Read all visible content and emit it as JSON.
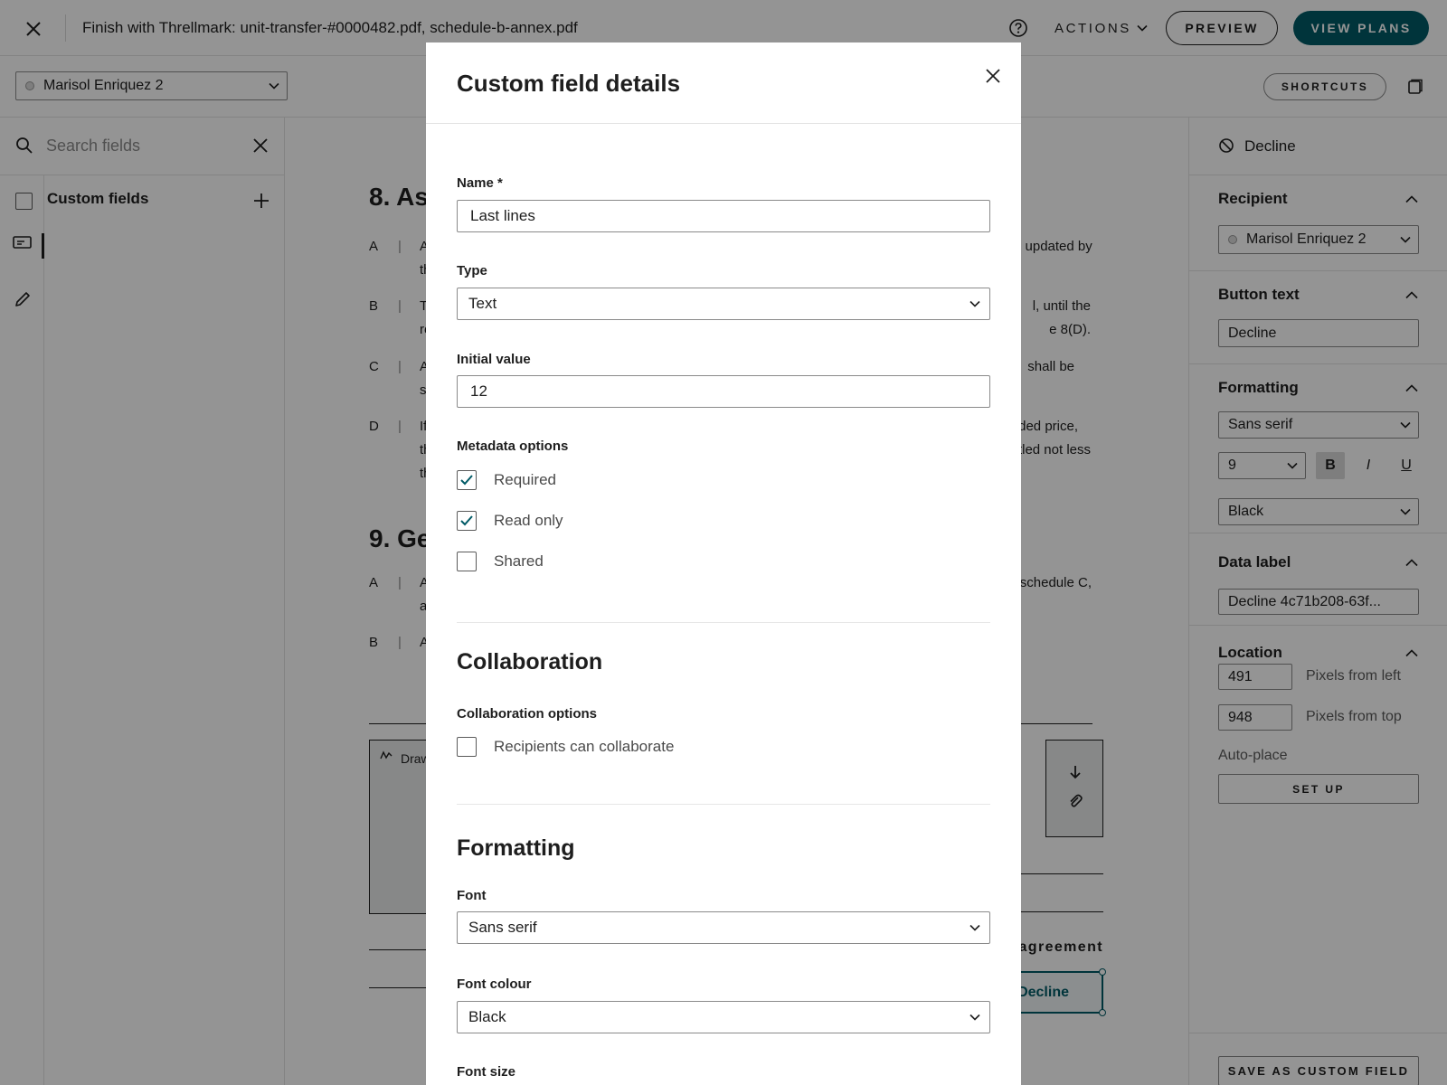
{
  "topbar": {
    "title": "Finish with Threllmark: unit-transfer-#0000482.pdf, schedule-b-annex.pdf",
    "actions_label": "ACTIONS",
    "preview_label": "PREVIEW",
    "view_plans_label": "VIEW PLANS"
  },
  "subbar": {
    "recipient_select": "Marisol Enriquez 2",
    "shortcuts_label": "SHORTCUTS"
  },
  "left_panel": {
    "search_placeholder": "Search fields",
    "custom_fields_label": "Custom fields"
  },
  "document": {
    "heading8": "8. As",
    "heading9": "9. Ge",
    "rows": [
      {
        "letter": "A",
        "frag_left": "A",
        "frag_left2": "th",
        "frag_right": "n updated by",
        "frag_right2": ""
      },
      {
        "letter": "B",
        "frag_left": "T",
        "frag_left2": "re",
        "frag_right": "l, until the",
        "frag_right2": "e 8(D)."
      },
      {
        "letter": "C",
        "frag_left": "A",
        "frag_left2": "s",
        "frag_right": "shall be",
        "frag_right2": ""
      },
      {
        "letter": "D",
        "frag_left": "If",
        "frag_left2": "th",
        "frag_right": "rded price,",
        "frag_right2": "tled not less",
        "frag_left3": "th"
      }
    ],
    "rows9": [
      {
        "letter": "A",
        "frag_left": "A",
        "frag_left2": "a",
        "frag_right": "n schedule C,"
      },
      {
        "letter": "B",
        "frag_left": "A"
      }
    ],
    "draw_label": "Draw",
    "agreement_text": "agreement",
    "decline_field": "Decline"
  },
  "right_panel": {
    "decline_title": "Decline",
    "recipient_heading": "Recipient",
    "recipient_value": "Marisol Enriquez 2",
    "button_text_heading": "Button text",
    "button_text_value": "Decline",
    "formatting_heading": "Formatting",
    "font_value": "Sans serif",
    "size_value": "9",
    "bold": "B",
    "italic": "I",
    "underline": "U",
    "color_value": "Black",
    "data_label_heading": "Data label",
    "data_label_value": "Decline 4c71b208-63f...",
    "location_heading": "Location",
    "left_value": "491",
    "left_label": "Pixels from left",
    "top_value": "948",
    "top_label": "Pixels from top",
    "autoplace_label": "Auto-place",
    "setup_label": "SET UP",
    "save_custom_label": "SAVE AS CUSTOM FIELD"
  },
  "modal": {
    "title": "Custom field details",
    "name_label": "Name *",
    "name_value": "Last lines",
    "type_label": "Type",
    "type_value": "Text",
    "initial_label": "Initial value",
    "initial_value": "12",
    "metadata_label": "Metadata options",
    "required_label": "Required",
    "required_checked": true,
    "readonly_label": "Read only",
    "readonly_checked": true,
    "shared_label": "Shared",
    "shared_checked": false,
    "collab_section": "Collaboration",
    "collab_options_label": "Collaboration options",
    "collab_checkbox_label": "Recipients can collaborate",
    "collab_checked": false,
    "formatting_section": "Formatting",
    "font_label": "Font",
    "font_value": "Sans serif",
    "font_colour_label": "Font colour",
    "font_colour_value": "Black",
    "font_size_label": "Font size"
  },
  "colors": {
    "primary": "#005a66",
    "overlay": "rgba(0,0,0,0.42)",
    "checkbox_check": "#005a66"
  },
  "icons": {
    "close": "close-icon",
    "help": "help-icon",
    "chevron": "chevron-down-icon",
    "sidebar_toggle": "sidebar-toggle-icon",
    "search": "search-icon",
    "clear": "clear-icon",
    "plus": "plus-icon",
    "text_field": "text-field-icon",
    "pen": "pen-icon",
    "decline": "decline-icon",
    "chevron_up": "chevron-up-icon",
    "signature": "signature-icon",
    "arrow_down": "arrow-down-icon",
    "paperclip": "paperclip-icon",
    "check": "check-icon"
  }
}
